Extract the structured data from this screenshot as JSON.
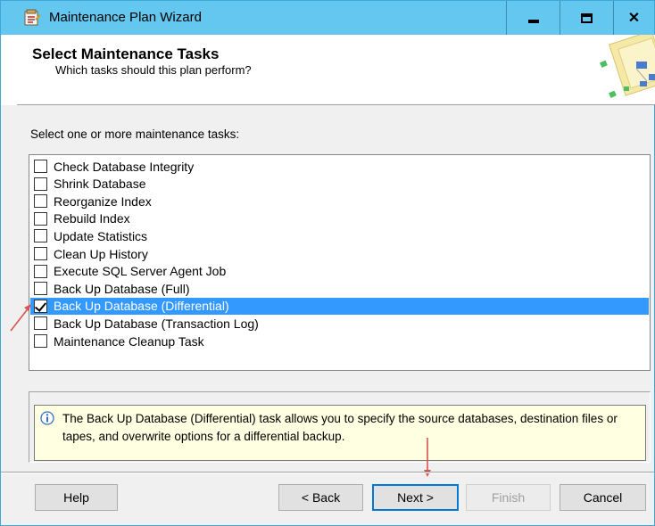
{
  "window": {
    "title": "Maintenance Plan Wizard"
  },
  "header": {
    "title": "Select Maintenance Tasks",
    "subtitle": "Which tasks should this plan perform?"
  },
  "instruction": "Select one or more maintenance tasks:",
  "tasks": [
    {
      "label": "Check Database Integrity",
      "checked": false,
      "selected": false
    },
    {
      "label": "Shrink Database",
      "checked": false,
      "selected": false
    },
    {
      "label": "Reorganize Index",
      "checked": false,
      "selected": false
    },
    {
      "label": "Rebuild Index",
      "checked": false,
      "selected": false
    },
    {
      "label": "Update Statistics",
      "checked": false,
      "selected": false
    },
    {
      "label": "Clean Up History",
      "checked": false,
      "selected": false
    },
    {
      "label": "Execute SQL Server Agent Job",
      "checked": false,
      "selected": false
    },
    {
      "label": "Back Up Database (Full)",
      "checked": false,
      "selected": false
    },
    {
      "label": "Back Up Database (Differential)",
      "checked": true,
      "selected": true
    },
    {
      "label": "Back Up Database (Transaction Log)",
      "checked": false,
      "selected": false
    },
    {
      "label": "Maintenance Cleanup Task",
      "checked": false,
      "selected": false
    }
  ],
  "description": "The Back Up Database (Differential) task allows you to specify the source databases, destination files or tapes, and overwrite options for a differential backup.",
  "buttons": {
    "help": "Help",
    "back": "< Back",
    "next": "Next >",
    "finish": "Finish",
    "cancel": "Cancel"
  },
  "colors": {
    "titlebar": "#63c7ef",
    "selection": "#3399ff",
    "annotation": "#d9534f",
    "info_background": "#ffffe1"
  }
}
